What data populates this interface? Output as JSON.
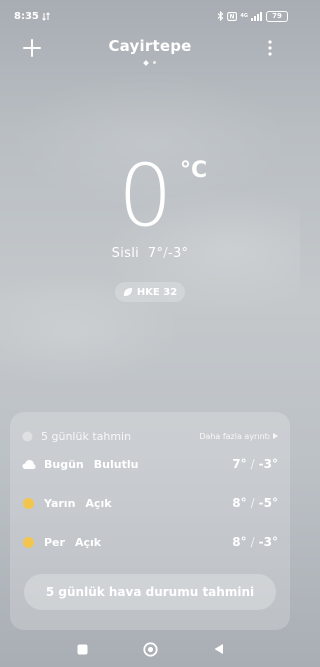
{
  "status_bar": {
    "time": "8:35",
    "network_label": "4G",
    "battery": "79"
  },
  "header": {
    "city": "Cayirtepe"
  },
  "current": {
    "temperature": "0",
    "unit": "°C",
    "condition": "Sisli",
    "high": "7°",
    "low": "-3°",
    "aqi_label": "HKE 32"
  },
  "forecast": {
    "title": "5 günlük tahmin",
    "more_label": "Daha fazla ayrıntı",
    "days": [
      {
        "day": "Bugün",
        "condition": "Bulutlu",
        "high": "7°",
        "low": "-3°",
        "icon": "cloud-icon"
      },
      {
        "day": "Yarın",
        "condition": "Açık",
        "high": "8°",
        "low": "-5°",
        "icon": "sun-icon"
      },
      {
        "day": "Per",
        "condition": "Açık",
        "high": "8°",
        "low": "-3°",
        "icon": "sun-icon"
      }
    ],
    "button_label": "5 günlük hava durumu tahmini"
  },
  "colors": {
    "sun": "#f2c54f",
    "text": "#ffffff"
  }
}
